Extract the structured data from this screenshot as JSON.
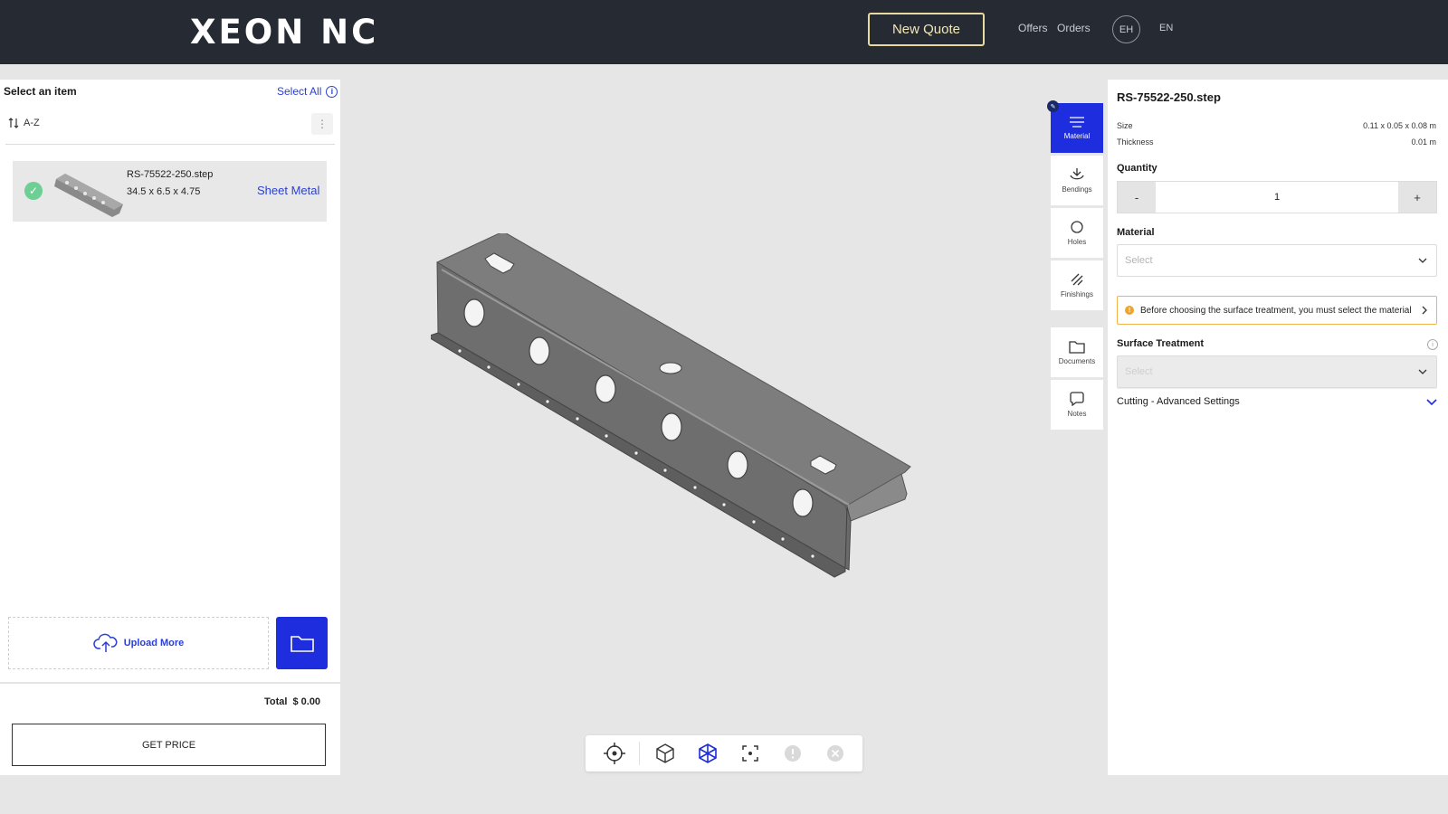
{
  "header": {
    "logo": "XEON NC",
    "new_quote": "New Quote",
    "nav": [
      "Offers",
      "Orders"
    ],
    "avatar": "EH",
    "lang": "EN"
  },
  "left": {
    "title": "Select an item",
    "select_all": "Select All",
    "sort": "A-Z",
    "items": [
      {
        "name": "RS-75522-250.step",
        "dims": "34.5 x 6.5 x 4.75",
        "type": "Sheet Metal",
        "selected": true
      }
    ],
    "upload_more": "Upload More",
    "total_label": "Total",
    "total_value": "$ 0.00",
    "get_price": "GET PRICE"
  },
  "tabs": [
    {
      "label": "Material",
      "icon": "lines-icon",
      "active": true
    },
    {
      "label": "Bendings",
      "icon": "bend-icon"
    },
    {
      "label": "Holes",
      "icon": "circle-icon"
    },
    {
      "label": "Finishings",
      "icon": "hatch-icon"
    },
    {
      "label": "Documents",
      "icon": "folder-icon"
    },
    {
      "label": "Notes",
      "icon": "note-icon"
    }
  ],
  "right": {
    "title": "RS-75522-250.step",
    "size_label": "Size",
    "size_value": "0.11 x 0.05 x 0.08 m",
    "thickness_label": "Thickness",
    "thickness_value": "0.01 m",
    "quantity_label": "Quantity",
    "qty_minus": "-",
    "qty_value": "1",
    "qty_plus": "+",
    "material_label": "Material",
    "material_placeholder": "Select",
    "warning": "Before choosing the surface treatment, you must select the material",
    "surface_label": "Surface Treatment",
    "surface_placeholder": "Select",
    "advanced": "Cutting - Advanced Settings"
  },
  "colors": {
    "accent": "#1e2ddd",
    "header_bg": "#262b33",
    "success": "#6dcf94",
    "warning": "#f0a52a"
  }
}
